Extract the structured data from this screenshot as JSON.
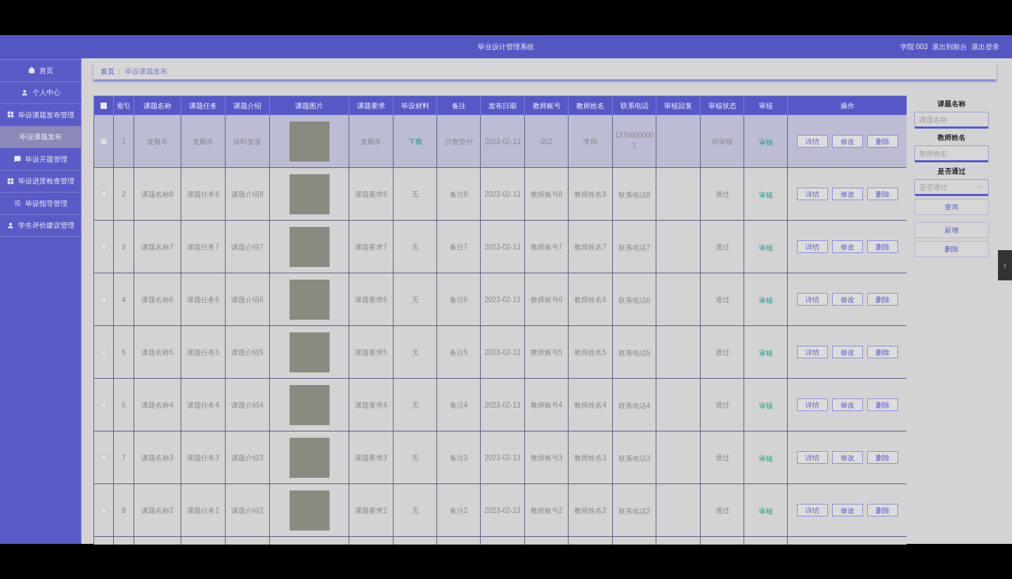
{
  "header": {
    "title": "毕业设计管理系统",
    "links": [
      "学院 003",
      "退出到前台",
      "退出登录"
    ]
  },
  "sidebar": {
    "items": [
      {
        "label": "首页",
        "selected": false
      },
      {
        "label": "个人中心",
        "selected": false
      },
      {
        "label": "毕设课题发布管理",
        "selected": false,
        "children": [
          {
            "label": "毕设课题发布",
            "selected": true
          }
        ]
      },
      {
        "label": "毕设开题管理",
        "selected": false
      },
      {
        "label": "毕设进度检查管理",
        "selected": false
      },
      {
        "label": "毕设指导管理",
        "selected": false
      },
      {
        "label": "学生评价建议管理",
        "selected": false
      }
    ]
  },
  "breadcrumb": {
    "items": [
      "首页",
      "毕设课题发布"
    ],
    "separator": ":"
  },
  "table": {
    "all_checked": false,
    "columns": [
      "索引",
      "课题名称",
      "课题任务",
      "课题介绍",
      "课题图片",
      "课题要求",
      "毕设材料",
      "备注",
      "发布日期",
      "教师账号",
      "教师姓名",
      "联系电话",
      "审核回复",
      "审核状态",
      "审核",
      "操作"
    ],
    "rows": [
      {
        "selected": true,
        "checked": false,
        "index": "1",
        "name": "发顺丰",
        "task": "发顺丰",
        "intro": "按时发发",
        "requirement": "发顺丰",
        "material": {
          "text": "下载",
          "kind": "link"
        },
        "note": "沙发垫付",
        "date": "2023-02-13",
        "account": "002",
        "teacher": "李四",
        "phone": "13700000001",
        "status": "待审核",
        "review": "审核",
        "actions": [
          "详情",
          "修改",
          "删除"
        ]
      },
      {
        "selected": false,
        "checked": false,
        "index": "2",
        "name": "课题名称8",
        "task": "课题任务8",
        "intro": "课题介绍8",
        "requirement": "课题要求8",
        "material": {
          "text": "无",
          "kind": "text"
        },
        "note": "备注8",
        "date": "2023-02-13",
        "account": "教师账号8",
        "teacher": "教师姓名8",
        "phone": "联系电话8",
        "status": "通过",
        "review": "审核",
        "actions": [
          "详情",
          "修改",
          "删除"
        ]
      },
      {
        "selected": false,
        "checked": false,
        "index": "3",
        "name": "课题名称7",
        "task": "课题任务7",
        "intro": "课题介绍7",
        "requirement": "课题要求7",
        "material": {
          "text": "无",
          "kind": "text"
        },
        "note": "备注7",
        "date": "2023-02-13",
        "account": "教师账号7",
        "teacher": "教师姓名7",
        "phone": "联系电话7",
        "status": "通过",
        "review": "审核",
        "actions": [
          "详情",
          "修改",
          "删除"
        ]
      },
      {
        "selected": false,
        "checked": false,
        "index": "4",
        "name": "课题名称6",
        "task": "课题任务6",
        "intro": "课题介绍6",
        "requirement": "课题要求6",
        "material": {
          "text": "无",
          "kind": "text"
        },
        "note": "备注6",
        "date": "2023-02-13",
        "account": "教师账号6",
        "teacher": "教师姓名6",
        "phone": "联系电话6",
        "status": "通过",
        "review": "审核",
        "actions": [
          "详情",
          "修改",
          "删除"
        ]
      },
      {
        "selected": false,
        "checked": false,
        "index": "5",
        "name": "课题名称5",
        "task": "课题任务5",
        "intro": "课题介绍5",
        "requirement": "课题要求5",
        "material": {
          "text": "无",
          "kind": "text"
        },
        "note": "备注5",
        "date": "2023-02-13",
        "account": "教师账号5",
        "teacher": "教师姓名5",
        "phone": "联系电话5",
        "status": "通过",
        "review": "审核",
        "actions": [
          "详情",
          "修改",
          "删除"
        ]
      },
      {
        "selected": false,
        "checked": false,
        "index": "6",
        "name": "课题名称4",
        "task": "课题任务4",
        "intro": "课题介绍4",
        "requirement": "课题要求4",
        "material": {
          "text": "无",
          "kind": "text"
        },
        "note": "备注4",
        "date": "2023-02-13",
        "account": "教师账号4",
        "teacher": "教师姓名4",
        "phone": "联系电话4",
        "status": "通过",
        "review": "审核",
        "actions": [
          "详情",
          "修改",
          "删除"
        ]
      },
      {
        "selected": false,
        "checked": false,
        "index": "7",
        "name": "课题名称3",
        "task": "课题任务3",
        "intro": "课题介绍3",
        "requirement": "课题要求3",
        "material": {
          "text": "无",
          "kind": "text"
        },
        "note": "备注3",
        "date": "2023-02-13",
        "account": "教师账号3",
        "teacher": "教师姓名3",
        "phone": "联系电话3",
        "status": "通过",
        "review": "审核",
        "actions": [
          "详情",
          "修改",
          "删除"
        ]
      },
      {
        "selected": false,
        "checked": false,
        "index": "8",
        "name": "课题名称2",
        "task": "课题任务2",
        "intro": "课题介绍2",
        "requirement": "课题要求2",
        "material": {
          "text": "无",
          "kind": "text"
        },
        "note": "备注2",
        "date": "2023-02-13",
        "account": "教师账号2",
        "teacher": "教师姓名2",
        "phone": "联系电话2",
        "status": "通过",
        "review": "审核",
        "actions": [
          "详情",
          "修改",
          "删除"
        ]
      }
    ]
  },
  "search": {
    "fields": [
      {
        "kind": "input",
        "label": "课题名称",
        "placeholder": "课题名称"
      },
      {
        "kind": "input",
        "label": "教师姓名",
        "placeholder": "教师姓名"
      },
      {
        "kind": "select",
        "label": "是否通过",
        "placeholder": "是否通过"
      }
    ],
    "query_button": "查询",
    "buttons": [
      "新增",
      "删除"
    ]
  }
}
